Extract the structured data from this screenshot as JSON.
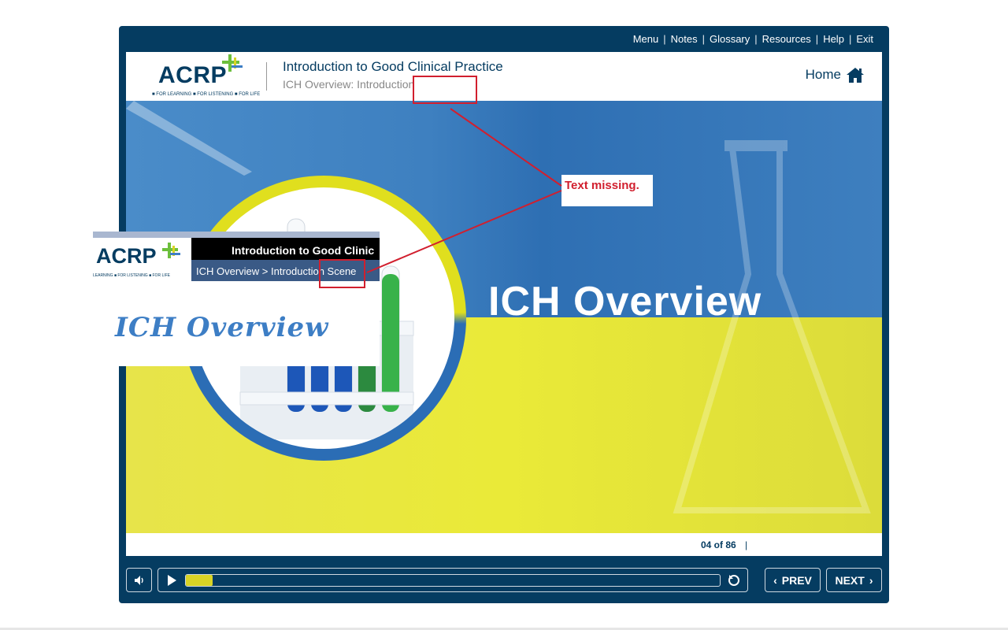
{
  "topnav": {
    "items": [
      "Menu",
      "Notes",
      "Glossary",
      "Resources",
      "Help",
      "Exit"
    ]
  },
  "header": {
    "logo_text": "ACRP",
    "logo_tagline": "■ FOR LEARNING ■ FOR LISTENING ■ FOR LIFE",
    "course_title": "Introduction to Good Clinical Practice",
    "slide_title": "ICH Overview: Introduction",
    "home_label": "Home"
  },
  "slide": {
    "big_title": "ICH Overview"
  },
  "footer": {
    "page_count": "04 of 86",
    "separator": "|"
  },
  "controls": {
    "progress_fraction": 0.05,
    "prev_label": "PREV",
    "next_label": "NEXT"
  },
  "inset": {
    "logo_text": "ACRP",
    "logo_tagline": "LEARNING ■ FOR LISTENING ■ FOR LIFE",
    "title": "Introduction to Good Clinic",
    "breadcrumb": "ICH Overview > Introduction Scene",
    "heading": "ICH Overview"
  },
  "annotation": {
    "label": "Text missing.",
    "color": "#d11f2e"
  },
  "colors": {
    "navy": "#053c61",
    "yellow": "#e0df1e",
    "blue": "#2b6db5"
  }
}
